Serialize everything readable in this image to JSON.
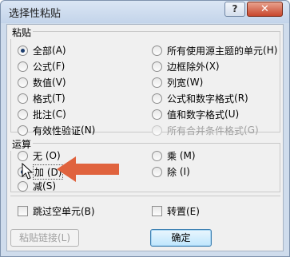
{
  "dialog": {
    "title": "选择性粘贴"
  },
  "titlebar": {
    "help_label": "?",
    "close_label": "✕"
  },
  "paste": {
    "label": "粘贴",
    "options": [
      {
        "text": "全部",
        "key": "(A)"
      },
      {
        "text": "公式",
        "key": "(F)"
      },
      {
        "text": "数值",
        "key": "(V)"
      },
      {
        "text": "格式",
        "key": "(T)"
      },
      {
        "text": "批注",
        "key": "(C)"
      },
      {
        "text": "有效性验证",
        "key": "(N)"
      },
      {
        "text": "所有使用源主题的单元",
        "key": "(H)"
      },
      {
        "text": "边框除外",
        "key": "(X)"
      },
      {
        "text": "列宽",
        "key": "(W)"
      },
      {
        "text": "公式和数字格式",
        "key": "(R)"
      },
      {
        "text": "值和数字格式",
        "key": "(U)"
      },
      {
        "text": "所有合并条件格式",
        "key": "(G)"
      }
    ]
  },
  "operation": {
    "label": "运算",
    "options": [
      {
        "text": "无",
        "key": "(O)"
      },
      {
        "text": "加",
        "key": "(D)"
      },
      {
        "text": "减",
        "key": "(S)"
      },
      {
        "text": "乘",
        "key": "(M)"
      },
      {
        "text": "除",
        "key": "(I)"
      }
    ]
  },
  "checks": {
    "skip_blanks": "跳过空单元(B)",
    "transpose": "转置(E)"
  },
  "buttons": {
    "paste_link": "粘贴链接(L)",
    "ok": "确定"
  },
  "colors": {
    "arrow": "#e0633e",
    "accent": "#1c3d6e"
  }
}
